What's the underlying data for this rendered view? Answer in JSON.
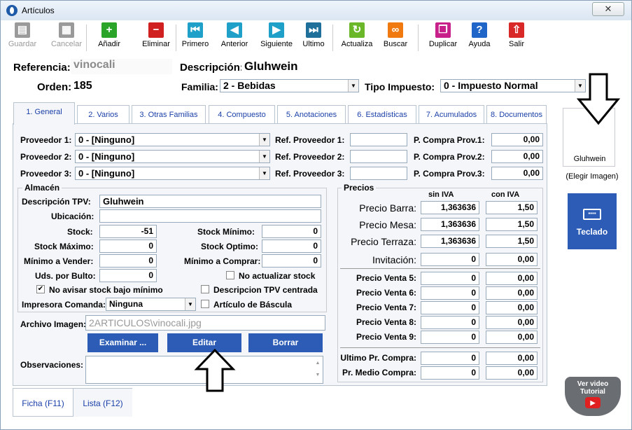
{
  "window": {
    "title": "Artículos",
    "close_label": "✕"
  },
  "toolbar": [
    {
      "label": "Guardar",
      "icon": "save-icon",
      "glyph": "▤",
      "color": "#9a9a9a",
      "disabled": true
    },
    {
      "label": "Cancelar",
      "icon": "cancel-icon",
      "glyph": "▦",
      "color": "#9a9a9a",
      "disabled": true
    },
    {
      "label": "Añadir",
      "icon": "add-icon",
      "glyph": "+",
      "color": "#2aa52a"
    },
    {
      "label": "Eliminar",
      "icon": "delete-icon",
      "glyph": "−",
      "color": "#d12020"
    },
    {
      "label": "Primero",
      "icon": "first-icon",
      "glyph": "⏮",
      "color": "#1fa0c8"
    },
    {
      "label": "Anterior",
      "icon": "previous-icon",
      "glyph": "◀",
      "color": "#1fa0c8"
    },
    {
      "label": "Siguiente",
      "icon": "next-icon",
      "glyph": "▶",
      "color": "#1fa0c8"
    },
    {
      "label": "Ultimo",
      "icon": "last-icon",
      "glyph": "⏭",
      "color": "#1e6f9a"
    },
    {
      "label": "Actualiza",
      "icon": "refresh-icon",
      "glyph": "↻",
      "color": "#6ab82a"
    },
    {
      "label": "Buscar",
      "icon": "binoculars-icon",
      "glyph": "∞",
      "color": "#f07a10"
    },
    {
      "label": "Duplicar",
      "icon": "duplicate-icon",
      "glyph": "❐",
      "color": "#c8208a"
    },
    {
      "label": "Ayuda",
      "icon": "help-icon",
      "glyph": "?",
      "color": "#1f66c8"
    },
    {
      "label": "Salir",
      "icon": "exit-icon",
      "glyph": "⇧",
      "color": "#d82828"
    }
  ],
  "header": {
    "referencia_label": "Referencia:",
    "referencia_value": "vinocali",
    "descripcion_label": "Descripción:",
    "descripcion_value": "Gluhwein",
    "orden_label": "Orden:",
    "orden_value": "185",
    "familia_label": "Familia:",
    "familia_value": "2 - Bebidas",
    "tipo_impuesto_label": "Tipo Impuesto:",
    "tipo_impuesto_value": "0 - Impuesto Normal"
  },
  "tabs": [
    {
      "label": "1. General",
      "active": true
    },
    {
      "label": "2. Varios"
    },
    {
      "label": "3. Otras Familias"
    },
    {
      "label": "4. Compuesto"
    },
    {
      "label": "5. Anotaciones"
    },
    {
      "label": "6. Estadísticas"
    },
    {
      "label": "7. Acumulados"
    },
    {
      "label": "8. Documentos"
    }
  ],
  "proveedores": [
    {
      "label": "Proveedor 1:",
      "value": "0 - [Ninguno]",
      "ref_label": "Ref. Proveedor 1:",
      "ref_value": "",
      "compra_label": "P. Compra Prov.1:",
      "compra_value": "0,00"
    },
    {
      "label": "Proveedor 2:",
      "value": "0 - [Ninguno]",
      "ref_label": "Ref. Proveedor 2:",
      "ref_value": "",
      "compra_label": "P. Compra Prov.2:",
      "compra_value": "0,00"
    },
    {
      "label": "Proveedor 3:",
      "value": "0 - [Ninguno]",
      "ref_label": "Ref. Proveedor 3:",
      "ref_value": "",
      "compra_label": "P. Compra Prov.3:",
      "compra_value": "0,00"
    }
  ],
  "almacen": {
    "title": "Almacén",
    "descripcion_tpv_label": "Descripción TPV:",
    "descripcion_tpv_value": "Gluhwein",
    "ubicacion_label": "Ubicación:",
    "ubicacion_value": "",
    "stock_label": "Stock:",
    "stock_value": "-51",
    "stock_minimo_label": "Stock Mínimo:",
    "stock_minimo_value": "0",
    "stock_maximo_label": "Stock Máximo:",
    "stock_maximo_value": "0",
    "stock_optimo_label": "Stock Optimo:",
    "stock_optimo_value": "0",
    "minimo_vender_label": "Mínimo a Vender:",
    "minimo_vender_value": "0",
    "minimo_comprar_label": "Mínimo a Comprar:",
    "minimo_comprar_value": "0",
    "uds_bulto_label": "Uds. por Bulto:",
    "uds_bulto_value": "0",
    "no_actualizar_label": "No actualizar stock",
    "no_actualizar_checked": false,
    "no_avisar_label": "No avisar stock bajo mínimo",
    "no_avisar_checked": true,
    "desc_tpv_centrada_label": "Descripcion TPV centrada",
    "desc_tpv_centrada_checked": false,
    "impresora_label": "Impresora Comanda:",
    "impresora_value": "Ninguna",
    "bascula_label": "Artículo de Báscula",
    "bascula_checked": false
  },
  "precios": {
    "title": "Precios",
    "sin_iva_header": "sin IVA",
    "con_iva_header": "con IVA",
    "main_rows": [
      {
        "label": "Precio Barra:",
        "sin": "1,363636",
        "con": "1,50"
      },
      {
        "label": "Precio Mesa:",
        "sin": "1,363636",
        "con": "1,50"
      },
      {
        "label": "Precio Terraza:",
        "sin": "1,363636",
        "con": "1,50"
      },
      {
        "label": "Invitación:",
        "sin": "0",
        "con": "0,00"
      }
    ],
    "venta_rows": [
      {
        "label": "Precio Venta 5:",
        "sin": "0",
        "con": "0,00"
      },
      {
        "label": "Precio Venta 6:",
        "sin": "0",
        "con": "0,00"
      },
      {
        "label": "Precio Venta 7:",
        "sin": "0",
        "con": "0,00"
      },
      {
        "label": "Precio Venta 8:",
        "sin": "0",
        "con": "0,00"
      },
      {
        "label": "Precio Venta 9:",
        "sin": "0",
        "con": "0,00"
      }
    ],
    "compra_rows": [
      {
        "label": "Ultimo Pr. Compra:",
        "sin": "0",
        "con": "0,00"
      },
      {
        "label": "Pr. Medio Compra:",
        "sin": "0",
        "con": "0,00"
      }
    ]
  },
  "imagen": {
    "archivo_label": "Archivo Imagen:",
    "archivo_value": "2ARTICULOS\\vinocali.jpg",
    "examinar_label": "Examinar ...",
    "editar_label": "Editar",
    "borrar_label": "Borrar"
  },
  "observaciones_label": "Observaciones:",
  "bottom_tabs": [
    {
      "label": "Ficha (F11)"
    },
    {
      "label": "Lista (F12)"
    }
  ],
  "side": {
    "image_caption": "Gluhwein",
    "elegir_imagen": "(Elegir Imagen)",
    "teclado_label": "Teclado",
    "video_line1": "Ver video",
    "video_line2": "Tutorial"
  }
}
